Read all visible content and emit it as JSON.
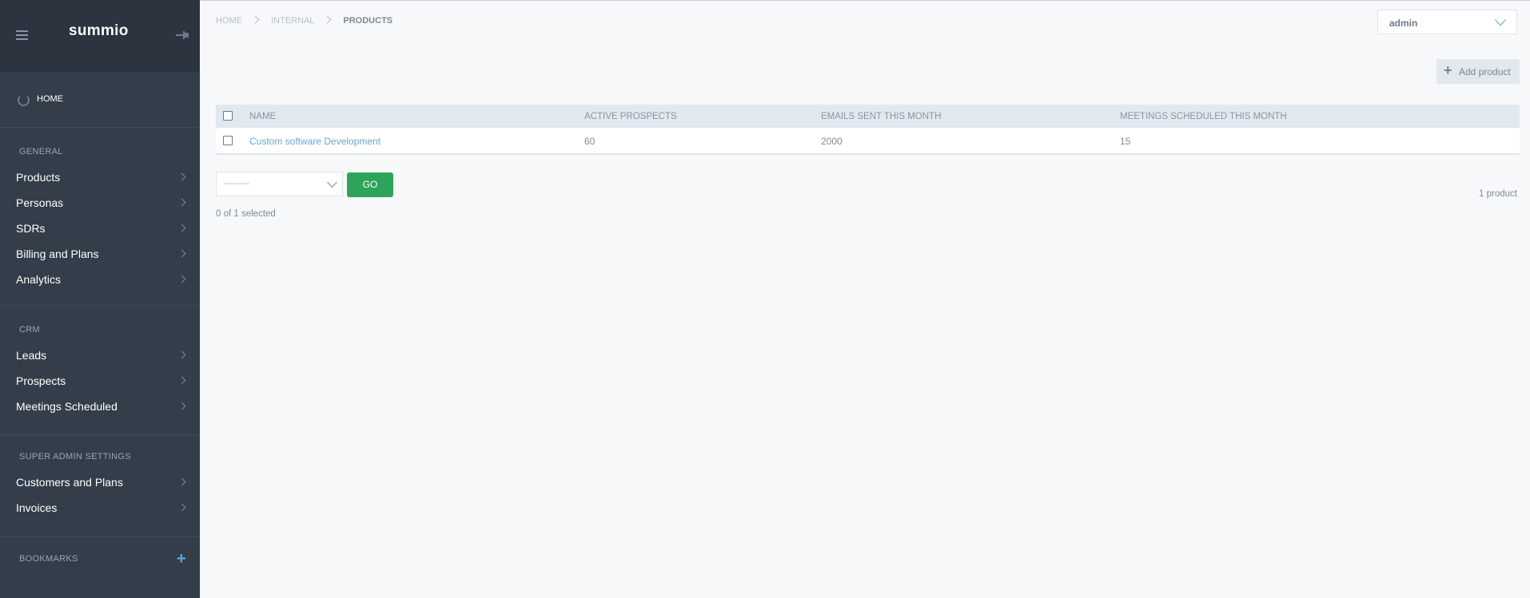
{
  "sidebar": {
    "logo": "summio",
    "home": "HOME",
    "sections": {
      "general": "GENERAL",
      "crm": "CRM",
      "super_admin": "SUPER ADMIN SETTINGS",
      "bookmarks": "BOOKMARKS"
    },
    "general_items": [
      "Products",
      "Personas",
      "SDRs",
      "Billing and Plans",
      "Analytics"
    ],
    "crm_items": [
      "Leads",
      "Prospects",
      "Meetings Scheduled"
    ],
    "admin_items": [
      "Customers and Plans",
      "Invoices"
    ],
    "bookmark_add": "+"
  },
  "breadcrumb": [
    "HOME",
    "INTERNAL",
    "PRODUCTS"
  ],
  "user_menu": {
    "value": "admin"
  },
  "add_product": {
    "label": "Add product",
    "icon": "plus-icon"
  },
  "table": {
    "columns": [
      "NAME",
      "ACTIVE PROSPECTS",
      "EMAILS SENT THIS MONTH",
      "MEETINGS SCHEDULED THIS MONTH"
    ],
    "rows": [
      {
        "name": "Custom software Development",
        "active_prospects": "60",
        "emails_sent": "2000",
        "meetings": "15"
      }
    ]
  },
  "actions": {
    "select_value": "---------",
    "go_label": "GO",
    "selected_text": "0 of 1 selected",
    "result_count": "1 product"
  },
  "colors": {
    "sidebar_bg": "#333e4a",
    "sidebar_header_bg": "#2b343f",
    "go_button": "#2ea45a",
    "link": "#6ba4d6"
  }
}
